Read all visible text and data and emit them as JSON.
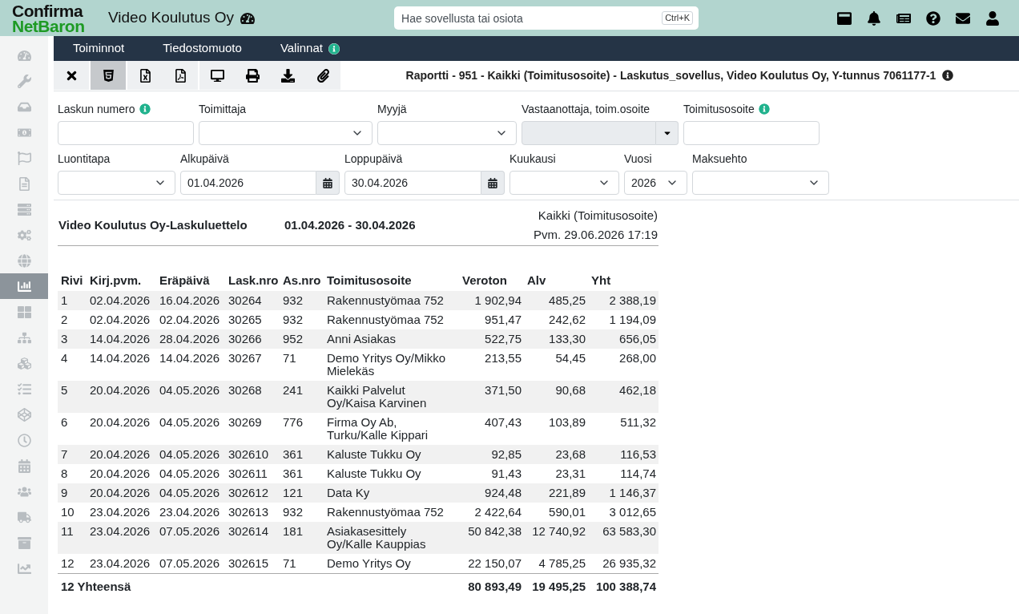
{
  "header": {
    "logo": {
      "line_1": "Confirma",
      "line_2": "NetBaron"
    },
    "company": "Video Koulutus Oy",
    "search": {
      "placeholder": "Hae sovellusta tai osiota",
      "shortcut": "Ctrl+K"
    }
  },
  "sidebar": {
    "items": [
      {
        "selected": false
      },
      {
        "selected": false
      },
      {
        "selected": false
      },
      {
        "selected": false
      },
      {
        "selected": false
      },
      {
        "selected": false
      },
      {
        "selected": false
      },
      {
        "selected": false
      },
      {
        "selected": false
      },
      {
        "selected": true
      },
      {
        "selected": false
      },
      {
        "selected": false
      },
      {
        "selected": false
      },
      {
        "selected": false
      },
      {
        "selected": false
      },
      {
        "selected": false
      },
      {
        "selected": false
      },
      {
        "selected": false
      },
      {
        "selected": false
      },
      {
        "selected": false
      },
      {
        "selected": false
      }
    ]
  },
  "menubar": {
    "items": [
      {
        "label": "Toiminnot",
        "info": false
      },
      {
        "label": "Tiedostomuoto",
        "info": false
      },
      {
        "label": "Valinnat",
        "info": true
      }
    ]
  },
  "toolbar": {
    "buttons": [
      {
        "selected": false
      },
      {
        "selected": true
      },
      {
        "selected": false
      },
      {
        "selected": false
      },
      {
        "selected": false
      },
      {
        "selected": false
      },
      {
        "selected": false
      },
      {
        "selected": false
      }
    ],
    "title": "Raportti - 951 - Kaikki (Toimitusosoite) - Laskutus_sovellus, Video Koulutus Oy, Y-tunnus 7061177-1"
  },
  "filters": {
    "lines": [
      {
        "fields": [
          {
            "label": "Laskun numero",
            "info": true,
            "kind": "text",
            "disabled": false
          },
          {
            "label": "Toimittaja",
            "info": false,
            "kind": "select",
            "disabled": false
          },
          {
            "label": "Myyjä",
            "info": false,
            "kind": "select",
            "disabled": false
          },
          {
            "label": "Vastaanottaja, toim.osoite",
            "info": false,
            "kind": "combo",
            "disabled": true
          },
          {
            "label": "Toimitusosoite",
            "info": true,
            "kind": "text",
            "disabled": false
          }
        ]
      },
      {
        "fields": [
          {
            "label": "Luontitapa",
            "info": false,
            "kind": "select",
            "disabled": false
          },
          {
            "label": "Alkupäivä",
            "info": false,
            "kind": "date",
            "disabled": false,
            "value": "01.04.2026"
          },
          {
            "label": "Loppupäivä",
            "info": false,
            "kind": "date",
            "disabled": false,
            "value": "30.04.2026"
          },
          {
            "label": "Kuukausi",
            "info": false,
            "kind": "select",
            "disabled": false
          },
          {
            "label": "Vuosi",
            "info": false,
            "kind": "select",
            "disabled": false,
            "value": "2026"
          },
          {
            "label": "Maksuehto",
            "info": false,
            "kind": "select",
            "disabled": false
          }
        ]
      }
    ]
  },
  "report": {
    "title": "Video Koulutus Oy-Laskuluettelo",
    "period": "01.04.2026 - 30.04.2026",
    "scope": "Kaikki (Toimitusosoite)",
    "printed": "Pvm. 29.06.2026 17:19"
  },
  "table": {
    "columns": [
      "Rivi",
      "Kirj.pvm.",
      "Eräpäivä",
      "Lask.nro",
      "As.nro",
      "Toimitusosoite",
      "Veroton",
      "Alv",
      "Yht"
    ],
    "rows": [
      [
        "1",
        "02.04.2026",
        "16.04.2026",
        "30264",
        "932",
        "Rakennustyömaa 752",
        "1 902,94",
        "485,25",
        "2 388,19"
      ],
      [
        "2",
        "02.04.2026",
        "02.04.2026",
        "30265",
        "932",
        "Rakennustyömaa 752",
        "951,47",
        "242,62",
        "1 194,09"
      ],
      [
        "3",
        "14.04.2026",
        "28.04.2026",
        "30266",
        "952",
        "Anni Asiakas",
        "522,75",
        "133,30",
        "656,05"
      ],
      [
        "4",
        "14.04.2026",
        "14.04.2026",
        "30267",
        "71",
        "Demo Yritys Oy/Mikko Mielekäs",
        "213,55",
        "54,45",
        "268,00"
      ],
      [
        "5",
        "20.04.2026",
        "04.05.2026",
        "30268",
        "241",
        "Kaikki Palvelut Oy/Kaisa Karvinen",
        "371,50",
        "90,68",
        "462,18"
      ],
      [
        "6",
        "20.04.2026",
        "04.05.2026",
        "30269",
        "776",
        "Firma Oy Ab, Turku/Kalle Kippari",
        "407,43",
        "103,89",
        "511,32"
      ],
      [
        "7",
        "20.04.2026",
        "04.05.2026",
        "302610",
        "361",
        "Kaluste Tukku Oy",
        "92,85",
        "23,68",
        "116,53"
      ],
      [
        "8",
        "20.04.2026",
        "04.05.2026",
        "302611",
        "361",
        "Kaluste Tukku Oy",
        "91,43",
        "23,31",
        "114,74"
      ],
      [
        "9",
        "20.04.2026",
        "04.05.2026",
        "302612",
        "121",
        "Data Ky",
        "924,48",
        "221,89",
        "1 146,37"
      ],
      [
        "10",
        "23.04.2026",
        "23.04.2026",
        "302613",
        "932",
        "Rakennustyömaa 752",
        "2 422,64",
        "590,01",
        "3 012,65"
      ],
      [
        "11",
        "23.04.2026",
        "07.05.2026",
        "302614",
        "181",
        "Asiakasesittely Oy/Kalle Kauppias",
        "50 842,38",
        "12 740,92",
        "63 583,30"
      ],
      [
        "12",
        "23.04.2026",
        "07.05.2026",
        "302615",
        "71",
        "Demo Yritys Oy",
        "22 150,07",
        "4 785,25",
        "26 935,32"
      ]
    ],
    "footer": {
      "label": "12 Yhteensä",
      "totals": [
        "80 893,49",
        "19 495,25",
        "100 388,74"
      ]
    }
  }
}
